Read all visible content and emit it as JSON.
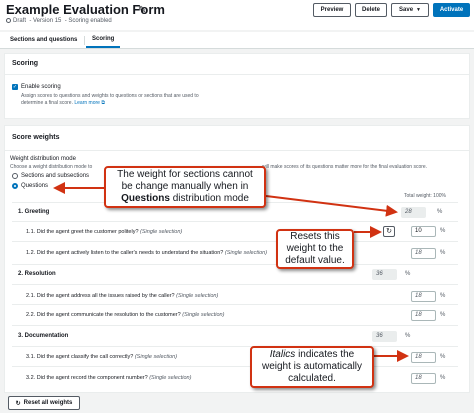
{
  "header": {
    "title": "Example Evaluation Form",
    "status": "Draft",
    "version": "Version 15",
    "scoring_state": "Scoring enabled",
    "buttons": {
      "preview": "Preview",
      "delete": "Delete",
      "save": "Save",
      "activate": "Activate"
    }
  },
  "tabs": [
    {
      "label": "Sections and questions"
    },
    {
      "label": "Scoring",
      "active": true
    }
  ],
  "scoring": {
    "title": "Scoring",
    "enable_label": "Enable scoring",
    "enabled": true,
    "help_line1": "Assign scores to questions and weights to questions or sections that are used to",
    "help_line2": "determine a final score.",
    "learn_more": "Learn more"
  },
  "weights": {
    "title": "Score weights",
    "mode_label": "Weight distribution mode",
    "mode_help_left": "Choose a weight distribution mode to",
    "mode_help_right": "will make scores of its questions matter more for the final evaluation score.",
    "options": [
      {
        "label": "Sections and subsections",
        "selected": false
      },
      {
        "label": "Questions",
        "selected": true
      }
    ],
    "total": "Total weight: 100%",
    "sections": [
      {
        "label": "1. Greeting",
        "weight": "28",
        "unit": "%",
        "questions": [
          {
            "label": "1.1. Did the agent greet the customer politely?",
            "type": "(Single selection)",
            "weight": "10",
            "unit": "%"
          },
          {
            "label": "1.2. Did the agent actively listen to the caller's needs to understand the situation?",
            "type": "(Single selection)",
            "weight": "18",
            "unit": "%"
          }
        ]
      },
      {
        "label": "2. Resolution",
        "weight": "36",
        "unit": "%",
        "questions": [
          {
            "label": "2.1. Did the agent address all the issues raised by the caller?",
            "type": "(Single selection)",
            "weight": "18",
            "unit": "%"
          },
          {
            "label": "2.2. Did the agent communicate the resolution to the customer?",
            "type": "(Single selection)",
            "weight": "18",
            "unit": "%"
          }
        ]
      },
      {
        "label": "3. Documentation",
        "weight": "36",
        "unit": "%",
        "questions": [
          {
            "label": "3.1. Did the agent classify the call correctly?",
            "type": "(Single selection)",
            "weight": "18",
            "unit": "%"
          },
          {
            "label": "3.2. Did the agent record the component number?",
            "type": "(Single selection)",
            "weight": "18",
            "unit": "%"
          }
        ]
      }
    ],
    "reset_all": "Reset all weights"
  },
  "callouts": {
    "c1_line1": "The weight for sections cannot",
    "c1_line2": "be change manually when in",
    "c1_bold": "Questions",
    "c1_tail": " distribution mode",
    "c2_line1": "Resets this",
    "c2_line2": "weight to the",
    "c2_line3": "default value.",
    "c3_italic": "Italics",
    "c3_line1_tail": " indicates the",
    "c3_line2": "weight is automatically",
    "c3_line3": "calculated."
  },
  "colors": {
    "accent": "#0073bb",
    "callout_border": "#d13212",
    "activate_bg": "#0073bb"
  }
}
